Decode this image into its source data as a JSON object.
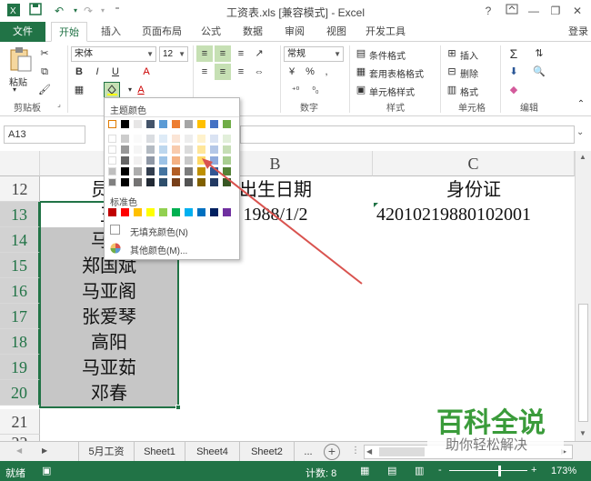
{
  "window": {
    "title": "工资表.xls  [兼容模式] - Excel",
    "help": "?",
    "login": "登录"
  },
  "tabs": [
    "文件",
    "开始",
    "插入",
    "页面布局",
    "公式",
    "数据",
    "审阅",
    "视图",
    "开发工具"
  ],
  "ribbon": {
    "paste": "粘贴",
    "clipboard": "剪贴板",
    "font_name": "宋体",
    "font_size": "12",
    "number_format": "常规",
    "number_group": "数字",
    "cond_format": "条件格式",
    "table_format": "套用表格格式",
    "cell_style": "单元格样式",
    "style_group": "样式",
    "insert": "插入",
    "delete": "删除",
    "format": "格式",
    "cells_group": "单元格",
    "edit_group": "编辑",
    "bold": "B",
    "italic": "I",
    "underline": "U",
    "sigma": "Σ",
    "percent": "%",
    "comma": ","
  },
  "formula_bar": {
    "name_box": "A13"
  },
  "grid": {
    "columns": [
      "B",
      "C"
    ],
    "rows": [
      "12",
      "13",
      "14",
      "15",
      "16",
      "17",
      "18",
      "19",
      "20",
      "21",
      "22"
    ],
    "colA": [
      "员工",
      "王",
      "马国",
      "郑国斌",
      "马亚阁",
      "张爱琴",
      "高阳",
      "马亚茹",
      "邓春",
      "",
      ""
    ],
    "colB": [
      "出生日期",
      "1988/1/2",
      "",
      "",
      "",
      "",
      "",
      "",
      "",
      "",
      ""
    ],
    "colC": [
      "身份证",
      "42010219880102001",
      "",
      "",
      "",
      "",
      "",
      "",
      "",
      "",
      ""
    ]
  },
  "sheets": [
    "5月工资",
    "Sheet1",
    "Sheet4",
    "Sheet2",
    "..."
  ],
  "status": {
    "ready": "就绪",
    "count": "计数: 8",
    "zoom": "173%",
    "minus": "-",
    "plus": "+"
  },
  "color_dropdown": {
    "theme_label": "主题颜色",
    "standard_label": "标准色",
    "no_fill": "无填充颜色(N)",
    "more_colors": "其他颜色(M)...",
    "theme_top": [
      "#ffffff",
      "#000000",
      "#e7e6e6",
      "#44546a",
      "#5b9bd5",
      "#ed7d31",
      "#a5a5a5",
      "#ffc000",
      "#4472c4",
      "#70ad47"
    ],
    "standard": [
      "#c00000",
      "#ff0000",
      "#ffc000",
      "#ffff00",
      "#92d050",
      "#00b050",
      "#00b0f0",
      "#0070c0",
      "#002060",
      "#7030a0"
    ]
  },
  "watermark": {
    "title": "百科全说",
    "subtitle": "助你轻松解决"
  },
  "colors": {
    "accent": "#217346",
    "selection": "#c6c6c6",
    "arrow": "#d9534f"
  }
}
